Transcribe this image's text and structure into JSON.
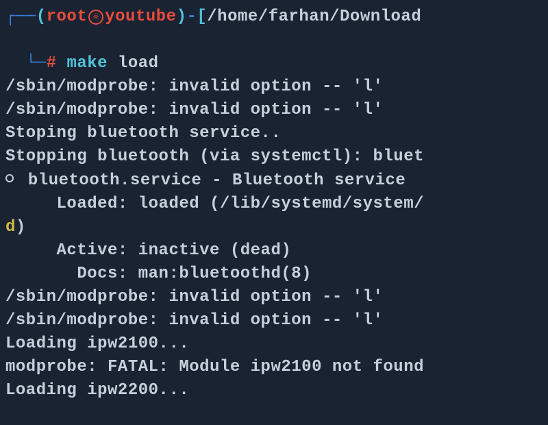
{
  "prompt": {
    "corner_top": "┌──",
    "paren_open": "(",
    "user": "root",
    "separator_icon": "skull",
    "host": "youtube",
    "paren_close": ")",
    "dash": "-",
    "bracket_open": "[",
    "path": "/home/farhan/Download",
    "corner_side": "└─",
    "hash": "#",
    "command": "make",
    "args": " load"
  },
  "output": {
    "l1": "/sbin/modprobe: invalid option -- 'l'",
    "l2": "/sbin/modprobe: invalid option -- 'l'",
    "l3": "Stoping bluetooth service..",
    "l4": "Stopping bluetooth (via systemctl): bluet",
    "l5": " bluetooth.service - Bluetooth service",
    "l6": "     Loaded: loaded (/lib/systemd/system/",
    "l7": "d",
    "l7b": ")",
    "l8": "     Active: inactive (dead)",
    "l9": "       Docs: man:bluetoothd(8)",
    "l10": "/sbin/modprobe: invalid option -- 'l'",
    "l11": "/sbin/modprobe: invalid option -- 'l'",
    "l12": "Loading ipw2100...",
    "l13": "modprobe: FATAL: Module ipw2100 not found",
    "l14": "Loading ipw2200..."
  }
}
